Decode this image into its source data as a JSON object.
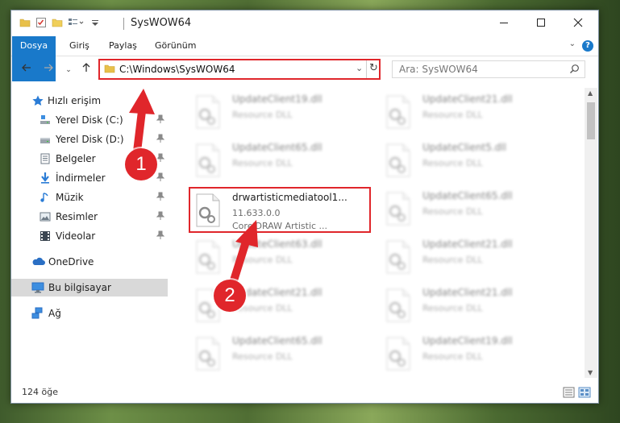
{
  "window": {
    "title": "SysWOW64"
  },
  "ribbon": {
    "tabs": [
      "Dosya",
      "Giriş",
      "Paylaş",
      "Görünüm"
    ],
    "help": "?"
  },
  "address": {
    "path": "C:\\Windows\\SysWOW64"
  },
  "search": {
    "placeholder": "Ara: SysWOW64"
  },
  "nav": {
    "items": [
      {
        "label": "Hızlı erişim",
        "icon": "star-icon"
      },
      {
        "label": "Yerel Disk (C:)",
        "icon": "drive-icon"
      },
      {
        "label": "Yerel Disk (D:)",
        "icon": "drive-icon"
      },
      {
        "label": "Belgeler",
        "icon": "documents-icon"
      },
      {
        "label": "İndirmeler",
        "icon": "download-icon"
      },
      {
        "label": "Müzik",
        "icon": "music-icon"
      },
      {
        "label": "Resimler",
        "icon": "pictures-icon"
      },
      {
        "label": "Videolar",
        "icon": "videos-icon"
      },
      {
        "label": "OneDrive",
        "icon": "cloud-icon"
      },
      {
        "label": "Bu bilgisayar",
        "icon": "computer-icon"
      },
      {
        "label": "Ağ",
        "icon": "network-icon"
      }
    ]
  },
  "files": {
    "left": [
      {
        "name": "UpdateClient19.dll",
        "sub": "Resource DLL"
      },
      {
        "name": "UpdateClient65.dll",
        "sub": "Resource DLL"
      },
      {
        "name": "UpdateClient63.dll",
        "sub": "Resource DLL"
      },
      {
        "name": "UpdateClient21.dll",
        "sub": "Resource DLL"
      },
      {
        "name": "UpdateClient65.dll",
        "sub": "Resource DLL"
      }
    ],
    "right": [
      {
        "name": "UpdateClient21.dll",
        "sub": "Resource DLL"
      },
      {
        "name": "UpdateClient5.dll",
        "sub": "Resource DLL"
      },
      {
        "name": "UpdateClient65.dll",
        "sub": "Resource DLL"
      },
      {
        "name": "UpdateClient21.dll",
        "sub": "Resource DLL"
      },
      {
        "name": "UpdateClient21.dll",
        "sub": "Resource DLL"
      },
      {
        "name": "UpdateClient19.dll",
        "sub": "Resource DLL"
      }
    ],
    "highlighted": {
      "name": "drwartisticmediatool1...",
      "version": "11.633.0.0",
      "description": "CorelDRAW Artistic ..."
    }
  },
  "status": {
    "count": "124 öğe"
  },
  "annotations": {
    "step1": "1",
    "step2": "2",
    "color": "#e0262b"
  },
  "colors": {
    "accent": "#1979ca",
    "selection": "#d9d9d9"
  }
}
